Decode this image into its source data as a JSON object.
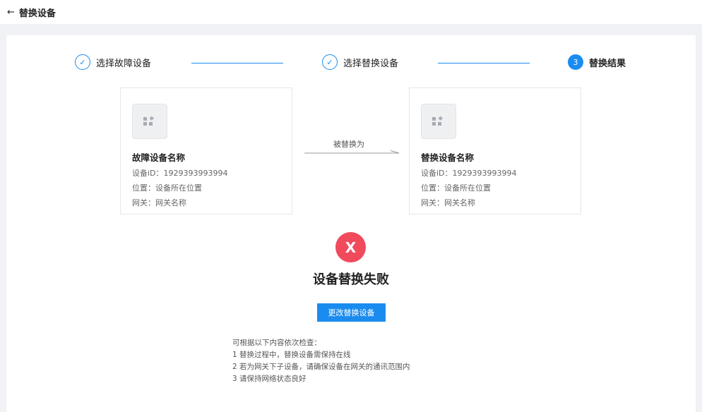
{
  "header": {
    "back_icon": "←",
    "title": "替换设备"
  },
  "steps": [
    {
      "label": "选择故障设备",
      "state": "done",
      "marker": "✓"
    },
    {
      "label": "选择替换设备",
      "state": "done",
      "marker": "✓"
    },
    {
      "label": "替换结果",
      "state": "active",
      "marker": "3"
    }
  ],
  "faulty_device": {
    "name": "故障设备名称",
    "id_line": "设备iD：1929393993994",
    "location_line": "位置：设备所在位置",
    "gateway_line": "网关：网关名称"
  },
  "replace_arrow_label": "被替换为",
  "replacement_device": {
    "name": "替换设备名称",
    "id_line": "设备iD：1929393993994",
    "location_line": "位置：设备所在位置",
    "gateway_line": "网关：网关名称"
  },
  "result": {
    "icon": "X",
    "title": "设备替换失败",
    "button_label": "更改替换设备"
  },
  "tips": [
    "可根据以下内容依次检查：",
    "1 替换过程中，替换设备需保持在线",
    "2 若为网关下子设备，请确保设备在网关的通讯范围内",
    "3 请保持网络状态良好"
  ],
  "colors": {
    "accent": "#1a8cf0",
    "error": "#f04a5c"
  }
}
